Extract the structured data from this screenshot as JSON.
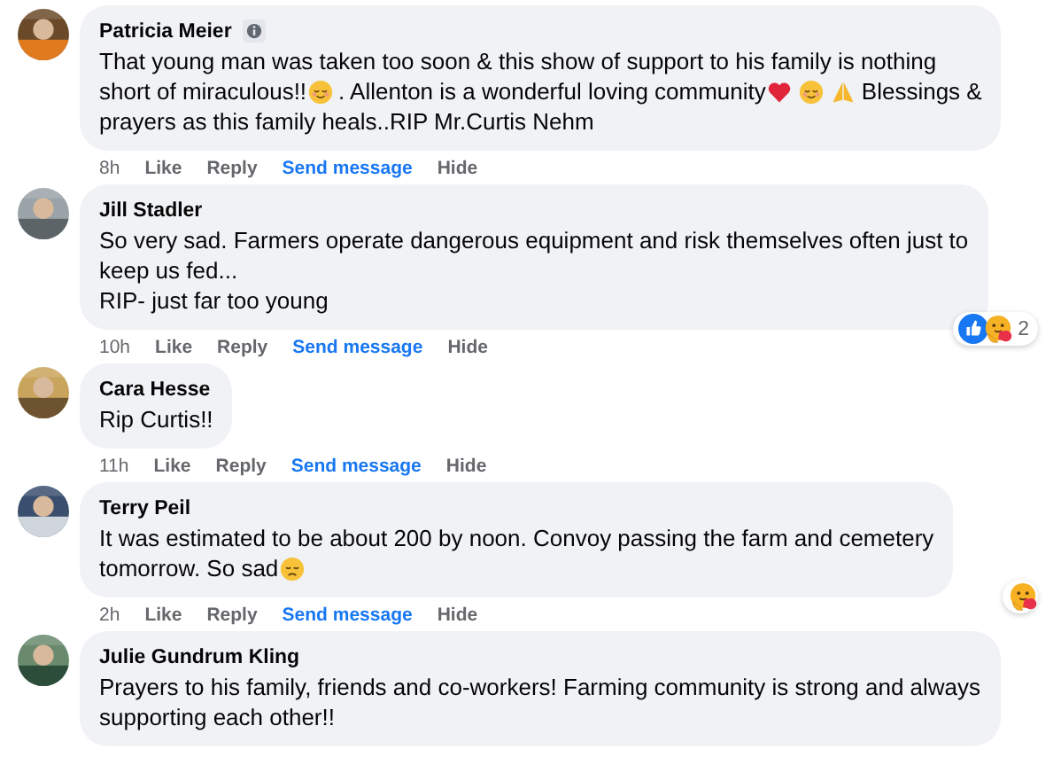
{
  "comments": [
    {
      "author": "Patricia Meier",
      "info_badge": true,
      "lines": [
        [
          {
            "kind": "text",
            "text": "That young man was taken too soon & this show of support to his family is nothing"
          }
        ],
        [
          {
            "kind": "text",
            "text": "short of miraculous!!"
          },
          {
            "kind": "relieved"
          },
          {
            "kind": "text",
            "text": ". Allenton is a wonderful loving community"
          },
          {
            "kind": "heart"
          },
          {
            "kind": "relieved"
          },
          {
            "kind": "pray"
          },
          {
            "kind": "text",
            "text": "Blessings &"
          }
        ],
        [
          {
            "kind": "text",
            "text": "prayers as this family heals..RIP Mr.Curtis Nehm"
          }
        ]
      ],
      "time": "8h",
      "actions": [
        {
          "label": "Like",
          "kind": "plain"
        },
        {
          "label": "Reply",
          "kind": "plain"
        },
        {
          "label": "Send message",
          "kind": "message"
        },
        {
          "label": "Hide",
          "kind": "plain"
        }
      ]
    },
    {
      "author": "Jill Stadler",
      "info_badge": false,
      "lines": [
        [
          {
            "kind": "text",
            "text": "So very sad. Farmers operate dangerous equipment and risk themselves often just to"
          }
        ],
        [
          {
            "kind": "text",
            "text": "keep us fed..."
          }
        ],
        [
          {
            "kind": "text",
            "text": "RIP- just far too young"
          }
        ]
      ],
      "time": "10h",
      "actions": [
        {
          "label": "Like",
          "kind": "plain"
        },
        {
          "label": "Reply",
          "kind": "plain"
        },
        {
          "label": "Send message",
          "kind": "message"
        },
        {
          "label": "Hide",
          "kind": "plain"
        }
      ],
      "reactions": {
        "icons": [
          {
            "kind": "like"
          },
          {
            "kind": "care"
          }
        ],
        "count": "2"
      }
    },
    {
      "author": "Cara Hesse",
      "info_badge": false,
      "lines": [
        [
          {
            "kind": "text",
            "text": "Rip Curtis!!"
          }
        ]
      ],
      "time": "11h",
      "actions": [
        {
          "label": "Like",
          "kind": "plain"
        },
        {
          "label": "Reply",
          "kind": "plain"
        },
        {
          "label": "Send message",
          "kind": "message"
        },
        {
          "label": "Hide",
          "kind": "plain"
        }
      ]
    },
    {
      "author": "Terry Peil",
      "info_badge": false,
      "lines": [
        [
          {
            "kind": "text",
            "text": "It was estimated to be about 200 by noon. Convoy passing the farm and cemetery"
          }
        ],
        [
          {
            "kind": "text",
            "text": "tomorrow. So sad"
          },
          {
            "kind": "sad"
          }
        ]
      ],
      "time": "2h",
      "actions": [
        {
          "label": "Like",
          "kind": "plain"
        },
        {
          "label": "Reply",
          "kind": "plain"
        },
        {
          "label": "Send message",
          "kind": "message"
        },
        {
          "label": "Hide",
          "kind": "plain"
        }
      ],
      "reactions": {
        "icons": [
          {
            "kind": "care"
          }
        ]
      }
    },
    {
      "author": "Julie Gundrum Kling",
      "info_badge": false,
      "lines": [
        [
          {
            "kind": "text",
            "text": "Prayers to his family, friends and co-workers! Farming community is strong and always"
          }
        ],
        [
          {
            "kind": "text",
            "text": "supporting each other!!"
          }
        ]
      ]
    }
  ]
}
